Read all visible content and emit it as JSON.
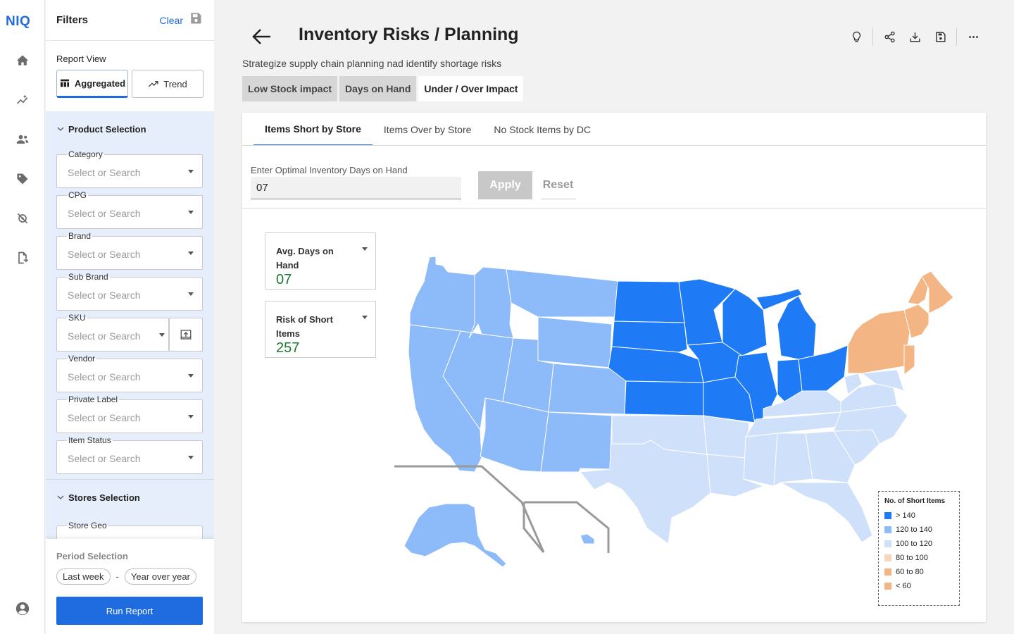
{
  "app": {
    "logo": "NIQ"
  },
  "rail": {
    "icons": [
      "home-icon",
      "analytics-icon",
      "users-icon",
      "tag-icon",
      "integration-icon",
      "export-icon",
      "account-icon"
    ]
  },
  "filters": {
    "title": "Filters",
    "clear_label": "Clear",
    "report_view_label": "Report View",
    "aggregated_label": "Aggregated",
    "trend_label": "Trend",
    "product_section_label": "Product Selection",
    "fields": [
      {
        "label": "Category",
        "placeholder": "Select or Search"
      },
      {
        "label": "CPG",
        "placeholder": "Select or Search"
      },
      {
        "label": "Brand",
        "placeholder": "Select or Search"
      },
      {
        "label": "Sub Brand",
        "placeholder": "Select or Search"
      },
      {
        "label": "SKU",
        "placeholder": "Select or Search"
      },
      {
        "label": "Vendor",
        "placeholder": "Select or Search"
      },
      {
        "label": "Private Label",
        "placeholder": "Select or Search"
      },
      {
        "label": "Item Status",
        "placeholder": "Select or Search"
      }
    ],
    "stores_section_label": "Stores Selection",
    "store_geo_label": "Store Geo",
    "period_label": "Period Selection",
    "period_from": "Last week",
    "period_dash": "-",
    "period_to": "Year over year",
    "run_label": "Run Report"
  },
  "header": {
    "title": "Inventory Risks / Planning",
    "subtitle": "Strategize supply chain planning nad identify shortage risks",
    "icons": [
      "lightbulb-icon",
      "share-icon",
      "download-icon",
      "save-icon",
      "more-icon"
    ]
  },
  "report_tabs": [
    "Low Stock impact",
    "Days on Hand",
    "Under / Over Impact"
  ],
  "active_report_tab": "Under / Over Impact",
  "sub_tabs": [
    "Items Short by Store",
    "Items Over by Store",
    "No Stock Items by DC"
  ],
  "active_sub_tab": "Items Short by Store",
  "days_on_hand": {
    "label": "Enter Optimal Inventory Days on Hand",
    "value": "07",
    "apply_label": "Apply",
    "reset_label": "Reset"
  },
  "metrics": [
    {
      "title": "Avg. Days on Hand",
      "value": "07"
    },
    {
      "title": "Risk of Short Items",
      "value": "257"
    }
  ],
  "legend": {
    "title": "No. of Short Items",
    "items": [
      {
        "label": "> 140",
        "color": "#1f7bf5"
      },
      {
        "label": "120 to 140",
        "color": "#8dbaf8"
      },
      {
        "label": "100 to 120",
        "color": "#cfe0fb"
      },
      {
        "label": "80 to 100",
        "color": "#f6d7bd"
      },
      {
        "label": "60 to 80",
        "color": "#f4b585"
      },
      {
        "label": "< 60",
        "color": "#f4b585"
      }
    ]
  },
  "colors": {
    "accent": "#1f6be0",
    "tier_high": "#1f7bf5",
    "tier_mid": "#8dbaf8",
    "tier_low": "#cfe0fb",
    "tier_orange": "#f4b585",
    "metric_value": "#1b7a2e"
  }
}
